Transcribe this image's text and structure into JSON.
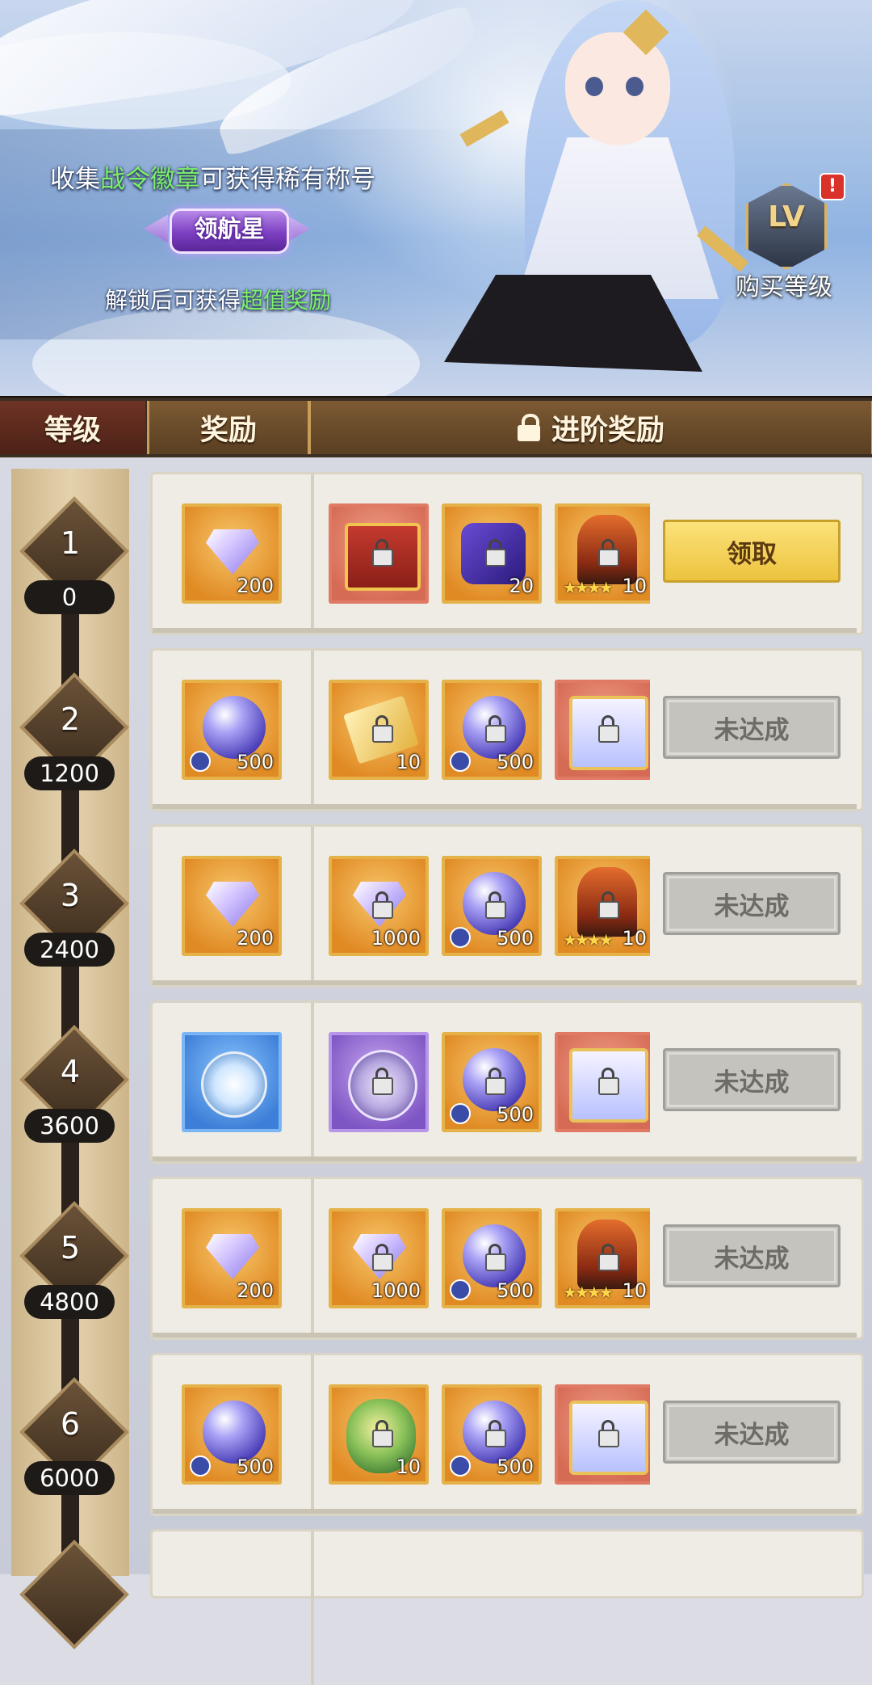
{
  "banner": {
    "line1_prefix": "收集",
    "line1_highlight": "战令徽章",
    "line1_suffix": "可获得稀有称号",
    "title_badge": "领航星",
    "line2_prefix": "解锁后可获得",
    "line2_highlight": "超值奖励",
    "buy_level": {
      "icon_text": "LV",
      "alert": "!",
      "label": "购买等级"
    }
  },
  "header": {
    "level": "等级",
    "reward": "奖励",
    "advanced_reward": "进阶奖励"
  },
  "colors": {
    "highlight_green": "#7df06a",
    "claim_button": "#edc33e",
    "locked_button": "#c4c3bd"
  },
  "rows": [
    {
      "level": "1",
      "points": "0",
      "free": {
        "icon": "crystal-gem-icon",
        "qty": "200"
      },
      "adv": [
        {
          "icon": "treasure-chest-icon",
          "qty": ""
        },
        {
          "icon": "puzzle-piece-icon",
          "qty": "20"
        },
        {
          "icon": "helmet-icon",
          "qty": "10"
        }
      ],
      "button": "领取"
    },
    {
      "level": "2",
      "points": "1200",
      "free": {
        "icon": "energy-orb-icon",
        "qty": "500"
      },
      "adv": [
        {
          "icon": "gold-book-icon",
          "qty": "10"
        },
        {
          "icon": "energy-orb-icon",
          "qty": "500"
        },
        {
          "icon": "silver-chest-icon",
          "qty": ""
        }
      ],
      "button": "未达成"
    },
    {
      "level": "3",
      "points": "2400",
      "free": {
        "icon": "crystal-gem-icon",
        "qty": "200"
      },
      "adv": [
        {
          "icon": "crystal-gem-icon",
          "qty": "1000"
        },
        {
          "icon": "energy-orb-icon",
          "qty": "500"
        },
        {
          "icon": "helmet-icon",
          "qty": "10"
        }
      ],
      "button": "未达成"
    },
    {
      "level": "4",
      "points": "3600",
      "free": {
        "icon": "snowflake-badge-icon",
        "qty": ""
      },
      "adv": [
        {
          "icon": "emblem-icon",
          "qty": ""
        },
        {
          "icon": "energy-orb-icon",
          "qty": "500"
        },
        {
          "icon": "silver-chest-icon",
          "qty": ""
        }
      ],
      "button": "未达成"
    },
    {
      "level": "5",
      "points": "4800",
      "free": {
        "icon": "crystal-gem-icon",
        "qty": "200"
      },
      "adv": [
        {
          "icon": "crystal-gem-icon",
          "qty": "1000"
        },
        {
          "icon": "energy-orb-icon",
          "qty": "500"
        },
        {
          "icon": "helmet-icon",
          "qty": "10"
        }
      ],
      "button": "未达成"
    },
    {
      "level": "6",
      "points": "6000",
      "free": {
        "icon": "energy-orb-icon",
        "qty": "500"
      },
      "adv": [
        {
          "icon": "leaf-bundle-icon",
          "qty": "10"
        },
        {
          "icon": "energy-orb-icon",
          "qty": "500"
        },
        {
          "icon": "silver-chest-icon",
          "qty": ""
        }
      ],
      "button": "未达成"
    }
  ]
}
